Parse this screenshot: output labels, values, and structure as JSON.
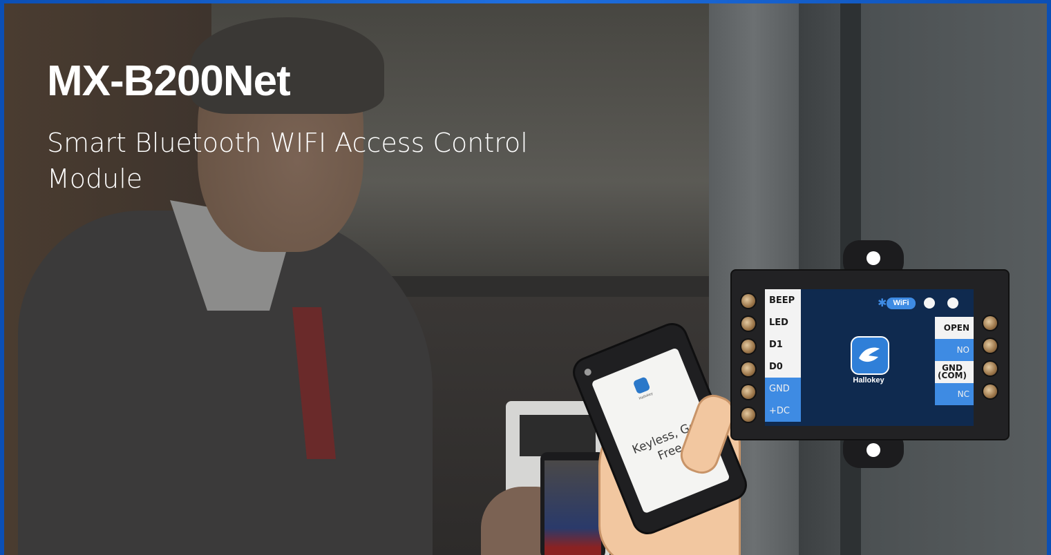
{
  "hero": {
    "title": "MX-B200Net",
    "subtitle": "Smart Bluetooth WIFI Access Control Module"
  },
  "phone": {
    "slogan": "Keyless, Go Free",
    "app_icon": "hallokey-app-icon"
  },
  "module": {
    "brand": "Hallokey",
    "wifi_badge": "WiFi",
    "left_terminals": [
      "BEEP",
      "LED",
      "D1",
      "D0",
      "GND",
      "+DC"
    ],
    "right_terminals": [
      "OPEN",
      "NO",
      "GND (COM)",
      "NC"
    ],
    "icons": [
      "bluetooth-icon",
      "wifi-icon",
      "hallokey-logo-icon"
    ]
  },
  "colors": {
    "frame_blue": "#1f6fe0",
    "module_face": "#0f2a4f",
    "terminal_blue": "#3e8be3",
    "text_white": "#ffffff"
  }
}
